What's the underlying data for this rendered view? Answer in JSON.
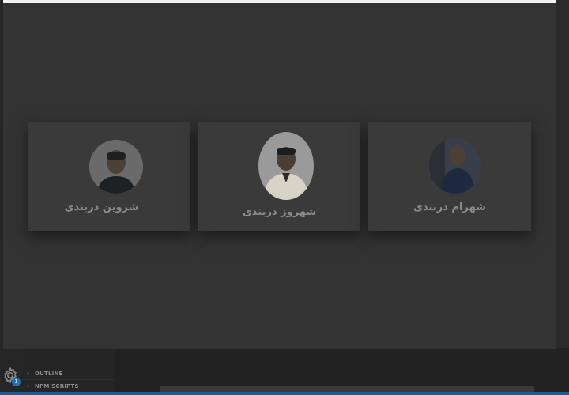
{
  "sidebar": {
    "sections": [
      {
        "label": "OUTLINE"
      },
      {
        "label": "NPM SCRIPTS"
      }
    ]
  },
  "activity": {
    "settings_badge": "1"
  },
  "preview": {
    "team": [
      {
        "name": "شروین دربندی"
      },
      {
        "name": "شهروز دربندی"
      },
      {
        "name": "شهرام دربندی"
      }
    ]
  }
}
